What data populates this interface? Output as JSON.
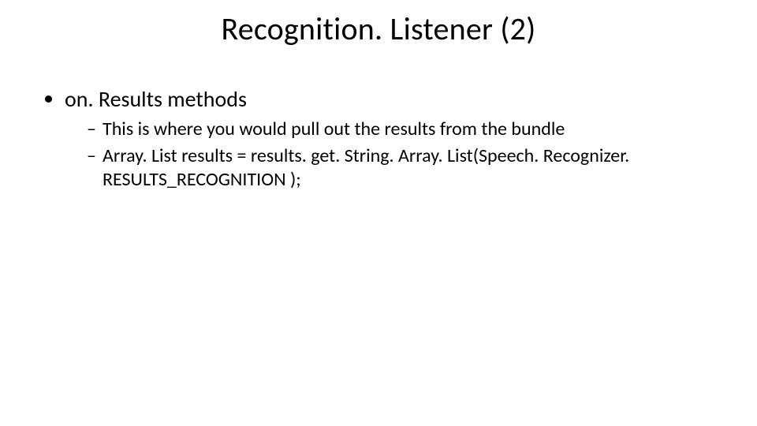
{
  "title": "Recognition. Listener (2)",
  "bullets": {
    "b1": "on. Results methods",
    "s1": "This is where you would pull out the results from the bundle",
    "s2": "Array. List results = results. get. String. Array. List(Speech. Recognizer. RESULTS_RECOGNITION );"
  }
}
